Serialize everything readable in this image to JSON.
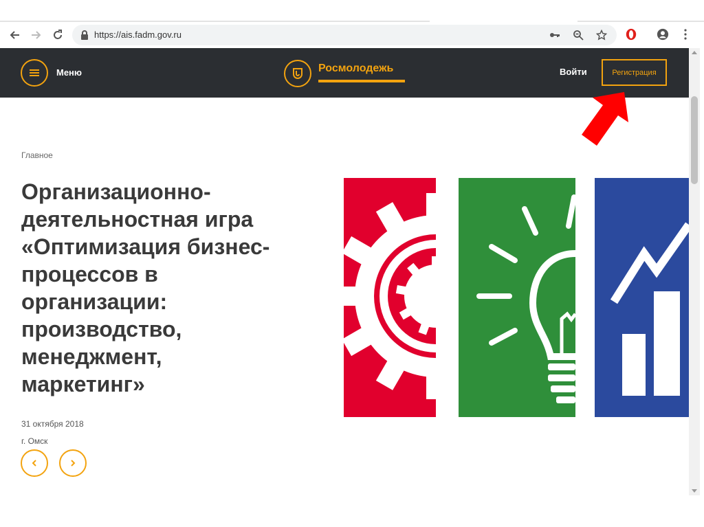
{
  "browser": {
    "url": "https://ais.fadm.gov.ru"
  },
  "header": {
    "menu_label": "Меню",
    "logo_text": "Росмолодежь",
    "login_label": "Войти",
    "register_label": "Регистрация"
  },
  "content": {
    "breadcrumb": "Главное",
    "headline_lines": [
      "Организационно-",
      "деятельностная игра",
      "«Оптимизация бизнес-",
      "процессов в",
      "организации:",
      "производство,",
      "менеджмент,",
      "маркетинг»"
    ],
    "date": "31 октября 2018",
    "city": "г. Омск"
  },
  "colors": {
    "accent": "#f3a30f",
    "header_bg": "#2b2e32",
    "panel_red": "#e1002d",
    "panel_green": "#2f8f3a",
    "panel_blue": "#2b4a9e",
    "annotation_arrow": "#ff0000"
  },
  "icons": {
    "back": "arrow-left-icon",
    "forward": "arrow-right-icon",
    "reload": "reload-icon",
    "lock": "lock-icon",
    "key": "key-icon",
    "zoom": "zoom-icon",
    "star": "star-icon",
    "opera": "opera-icon",
    "account": "account-icon",
    "more": "more-vertical-icon",
    "menu": "hamburger-icon",
    "logo": "rosmolodezh-logo-icon",
    "prev": "chevron-left-icon",
    "next": "chevron-right-icon"
  }
}
